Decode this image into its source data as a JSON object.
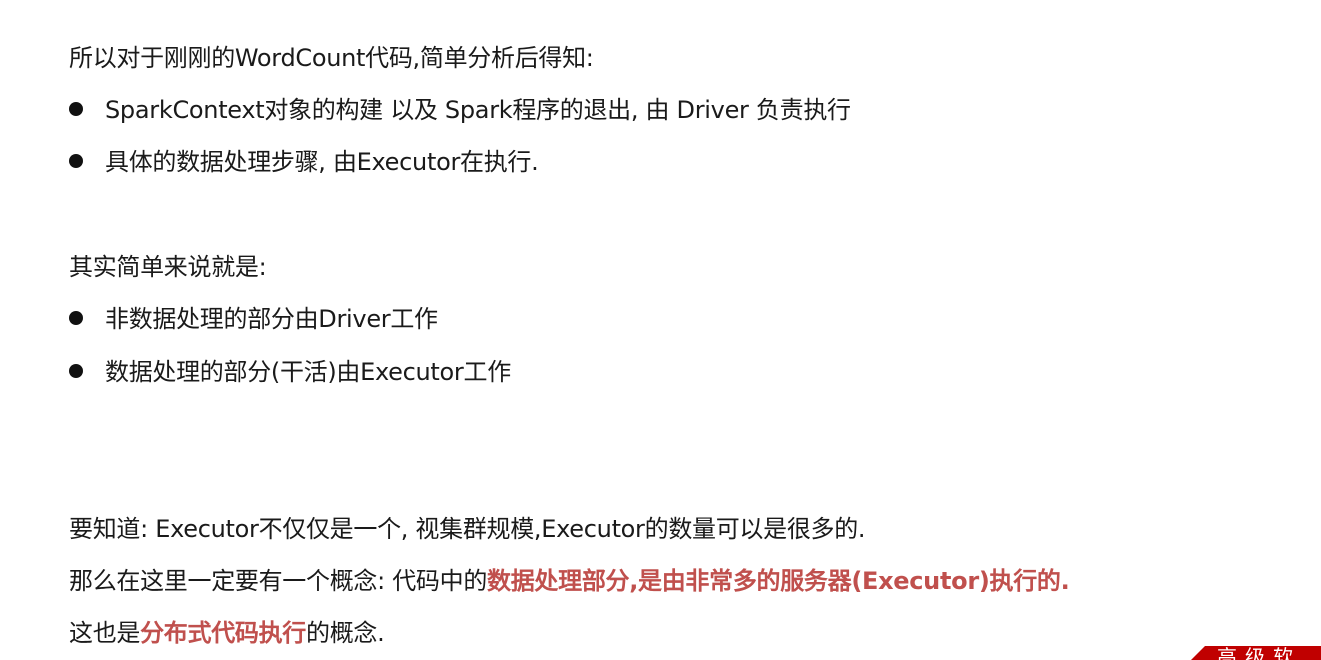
{
  "intro": "所以对于刚刚的WordCount代码,简单分析后得知:",
  "analysis_bullets": [
    "SparkContext对象的构建 以及 Spark程序的退出, 由 Driver 负责执行",
    "具体的数据处理步骤, 由Executor在执行."
  ],
  "summary_intro": "其实简单来说就是:",
  "summary_bullets": [
    "非数据处理的部分由Driver工作",
    "数据处理的部分(干活)由Executor工作"
  ],
  "note_line": "要知道: Executor不仅仅是一个, 视集群规模,Executor的数量可以是很多的.",
  "concept_line": {
    "prefix": "那么在这里一定要有一个概念: 代码中的",
    "highlight": "数据处理部分,是由非常多的服务器(Executor)执行的."
  },
  "distributed_line": {
    "prefix": "这也是",
    "highlight": "分布式代码执行",
    "suffix": "的概念."
  },
  "corner_banner": {
    "text": "高级软"
  },
  "colors": {
    "highlight": "#c0504d",
    "banner": "#c00000",
    "text": "#1a1a1a"
  }
}
